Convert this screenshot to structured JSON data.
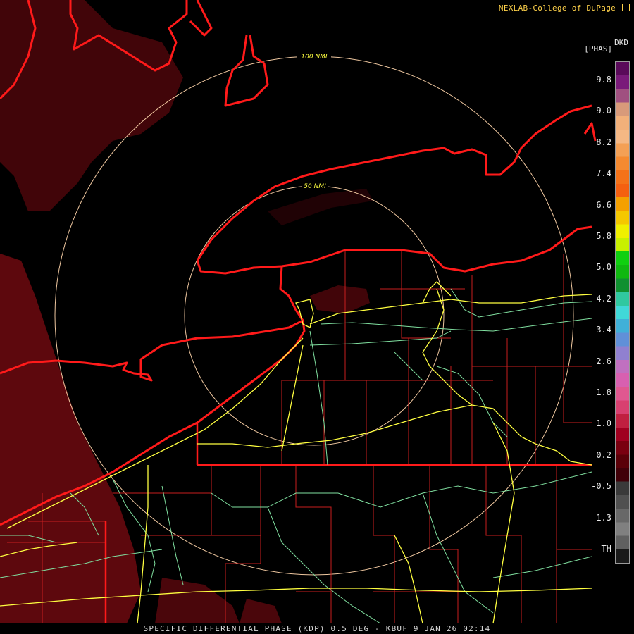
{
  "header": {
    "credit": "NEXLAB-College of DuPage"
  },
  "footer": {
    "product_title": "SPECIFIC DIFFERENTIAL PHASE (KDP) 0.5 DEG - KBUF 9 JAN 26 02:14"
  },
  "range_rings": [
    {
      "label": "100 NMI"
    },
    {
      "label": "50 NMI"
    }
  ],
  "legend": {
    "code": "DKD",
    "unit": "[PHAS]",
    "labels": [
      "9.8",
      "9.0",
      "8.2",
      "7.4",
      "6.6",
      "5.8",
      "5.0",
      "4.2",
      "3.4",
      "2.6",
      "1.8",
      "1.0",
      "0.2",
      "-0.5",
      "-1.3",
      "TH"
    ],
    "colors": [
      "#5a0a5a",
      "#7a1a7a",
      "#a05080",
      "#d89a7a",
      "#f2b07a",
      "#f5b884",
      "#f4a055",
      "#f58a30",
      "#f57218",
      "#f56010",
      "#f5a000",
      "#f5c800",
      "#f0f000",
      "#c8f000",
      "#10d010",
      "#10b810",
      "#109030",
      "#30c8a0",
      "#40d8d8",
      "#40b0d8",
      "#6090d8",
      "#9080d0",
      "#c070c0",
      "#d860b0",
      "#e05890",
      "#d84070",
      "#c02040",
      "#a00020",
      "#7a0010",
      "#5a0008",
      "#400008",
      "#3a3a3a",
      "#505050",
      "#686868",
      "#808080",
      "#606060",
      "#1a1a1a"
    ]
  },
  "colors": {
    "coastline": "#ff1a1a",
    "county_lines": "#c81e1e",
    "highways": "#ffff40",
    "roads": "#80e0a0",
    "range_ring": "#f0c8a0",
    "echo": "#6e0a10"
  }
}
